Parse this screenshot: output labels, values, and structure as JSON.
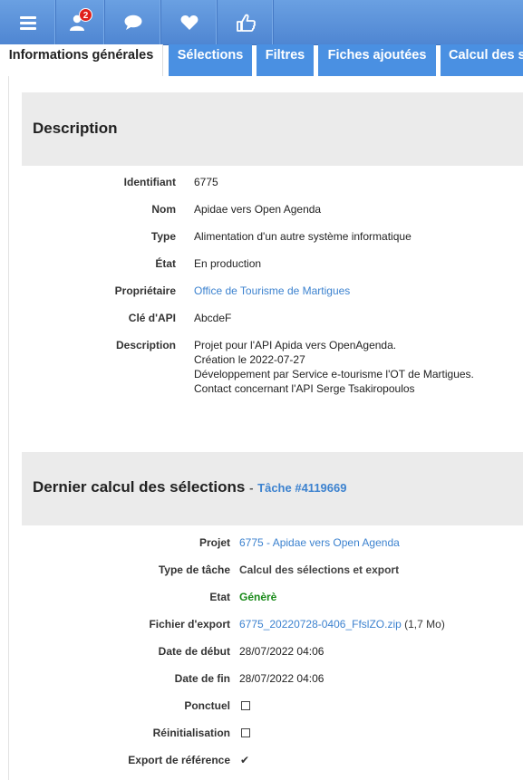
{
  "topbar": {
    "items": [
      {
        "icon": "menu-icon"
      },
      {
        "icon": "user-icon",
        "badge": "2"
      },
      {
        "icon": "chat-icon"
      },
      {
        "icon": "heart-icon"
      },
      {
        "icon": "thumb-icon"
      }
    ],
    "color": "#5b93dc"
  },
  "tabs": [
    {
      "label": "Informations générales",
      "active": true
    },
    {
      "label": "Sélections",
      "active": false
    },
    {
      "label": "Filtres",
      "active": false
    },
    {
      "label": "Fiches ajoutées",
      "active": false
    },
    {
      "label": "Calcul des s",
      "active": false
    }
  ],
  "description": {
    "title": "Description",
    "rows": {
      "identifiant": {
        "label": "Identifiant",
        "value": "6775"
      },
      "nom": {
        "label": "Nom",
        "value": "Apidae vers Open Agenda"
      },
      "type": {
        "label": "Type",
        "value": "Alimentation d'un autre système informatique"
      },
      "etat": {
        "label": "État",
        "value": "En production"
      },
      "proprietaire": {
        "label": "Propriétaire",
        "value": "Office de Tourisme de Martigues"
      },
      "cle": {
        "label": "Clé d'API",
        "value": "AbcdeF"
      },
      "description": {
        "label": "Description",
        "lines": [
          "Projet pour l'API Apida vers OpenAgenda.",
          "Création le 2022-07-27",
          "Développement par Service e-tourisme l'OT de Martigues.",
          "Contact concernant l'API Serge Tsakiropoulos"
        ]
      }
    }
  },
  "calcul": {
    "title": "Dernier calcul des sélections",
    "dash": "-",
    "task_link": "Tâche #4119669",
    "rows": {
      "projet": {
        "label": "Projet",
        "value": "6775 - Apidae vers Open Agenda"
      },
      "type_tache": {
        "label": "Type de tâche",
        "value": "Calcul des sélections et export"
      },
      "etat": {
        "label": "Etat",
        "value": "Génèrè"
      },
      "fichier": {
        "label": "Fichier d'export",
        "value": "6775_20220728-0406_FfslZO.zip",
        "size": "(1,7 Mo)"
      },
      "date_debut": {
        "label": "Date de début",
        "value": "28/07/2022 04:06"
      },
      "date_fin": {
        "label": "Date de fin",
        "value": "28/07/2022 04:06"
      },
      "ponctuel": {
        "label": "Ponctuel",
        "checked": false
      },
      "reinit": {
        "label": "Réinitialisation",
        "checked": false
      },
      "export_ref": {
        "label": "Export de référence",
        "checked": true,
        "check_glyph": "✔"
      }
    }
  }
}
